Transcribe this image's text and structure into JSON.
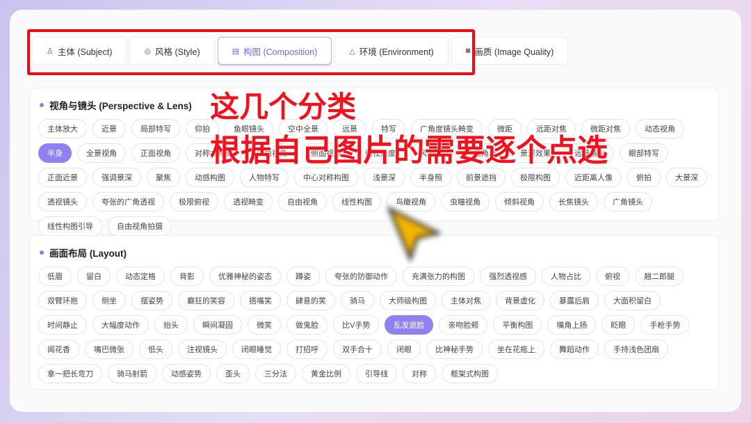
{
  "tabs": [
    {
      "icon": "person-icon",
      "label": "主体 (Subject)"
    },
    {
      "icon": "palette-icon",
      "label": "风格 (Style)"
    },
    {
      "icon": "layout-icon",
      "label": "构图 (Composition)",
      "active": true
    },
    {
      "icon": "mountain-icon",
      "label": "环境 (Environment)"
    },
    {
      "icon": "camera-icon",
      "label": "画质 (Image Quality)"
    }
  ],
  "perspective": {
    "title": "视角与镜头 (Perspective & Lens)",
    "selected": "半身",
    "chips": [
      "主体放大",
      "近景",
      "局部特写",
      "仰拍",
      "鱼眼镜头",
      "空中全景",
      "远景",
      "特写",
      "广角度镜头畸变",
      "微距",
      "远距对焦",
      "微距对焦",
      "动态视角",
      "半身",
      "全景视角",
      "正面视角",
      "对称式布局",
      "广角视角",
      "侧面视角",
      "俯视角度",
      "风中飘动",
      "低角度",
      "景深效果",
      "远景镜头",
      "眼部特写",
      "正面近景",
      "强调景深",
      "聚焦",
      "动感构图",
      "人物特写",
      "中心对称构图",
      "浅景深",
      "半身照",
      "前景遮挡",
      "极限构图",
      "近距离人像",
      "俯拍",
      "大景深",
      "透视镜头",
      "夸张的广角透视",
      "极限俯视",
      "透视畸变",
      "自由视角",
      "线性构图",
      "鸟瞰视角",
      "虫瞳视角",
      "倾斜视角",
      "长焦镜头",
      "广角镜头",
      "线性构图引导",
      "自由视角拍摄"
    ]
  },
  "layout": {
    "title": "画面布局 (Layout)",
    "selected": "乱发遮脸",
    "chips": [
      "低眉",
      "留白",
      "动态定格",
      "背影",
      "优雅神秘的姿态",
      "蹲姿",
      "夸张的防御动作",
      "充满张力的构图",
      "强烈透视感",
      "人物占比",
      "俯视",
      "翘二郎腿",
      "双臂环抱",
      "侧坐",
      "摆姿势",
      "癫狂的笑容",
      "捂嘴笑",
      "肆意的笑",
      "骑马",
      "大师级构图",
      "主体对焦",
      "背景虚化",
      "暴露后肩",
      "大面积留白",
      "时间静止",
      "大幅度动作",
      "抬头",
      "瞬间凝固",
      "微笑",
      "做鬼脸",
      "比V手势",
      "乱发遮脸",
      "亲吻脸颊",
      "平衡构图",
      "嘴角上扬",
      "眨眼",
      "手枪手势",
      "闻花香",
      "嘴巴微张",
      "低头",
      "注视镜头",
      "闭眼睡觉",
      "打招呼",
      "双手合十",
      "闭眼",
      "比神秘手势",
      "坐在花瓶上",
      "舞蹈动作",
      "手持浅色团扇",
      "拿一把长弯刀",
      "骑马射箭",
      "动感姿势",
      "歪头",
      "三分法",
      "黄金比例",
      "引导线",
      "对称",
      "框架式构图"
    ]
  },
  "annotations": {
    "line1": "这几个分类",
    "line2": "根据自己图片的需要逐个点选"
  },
  "colors": {
    "accent": "#8e81f2",
    "annotation": "#f5101c"
  }
}
